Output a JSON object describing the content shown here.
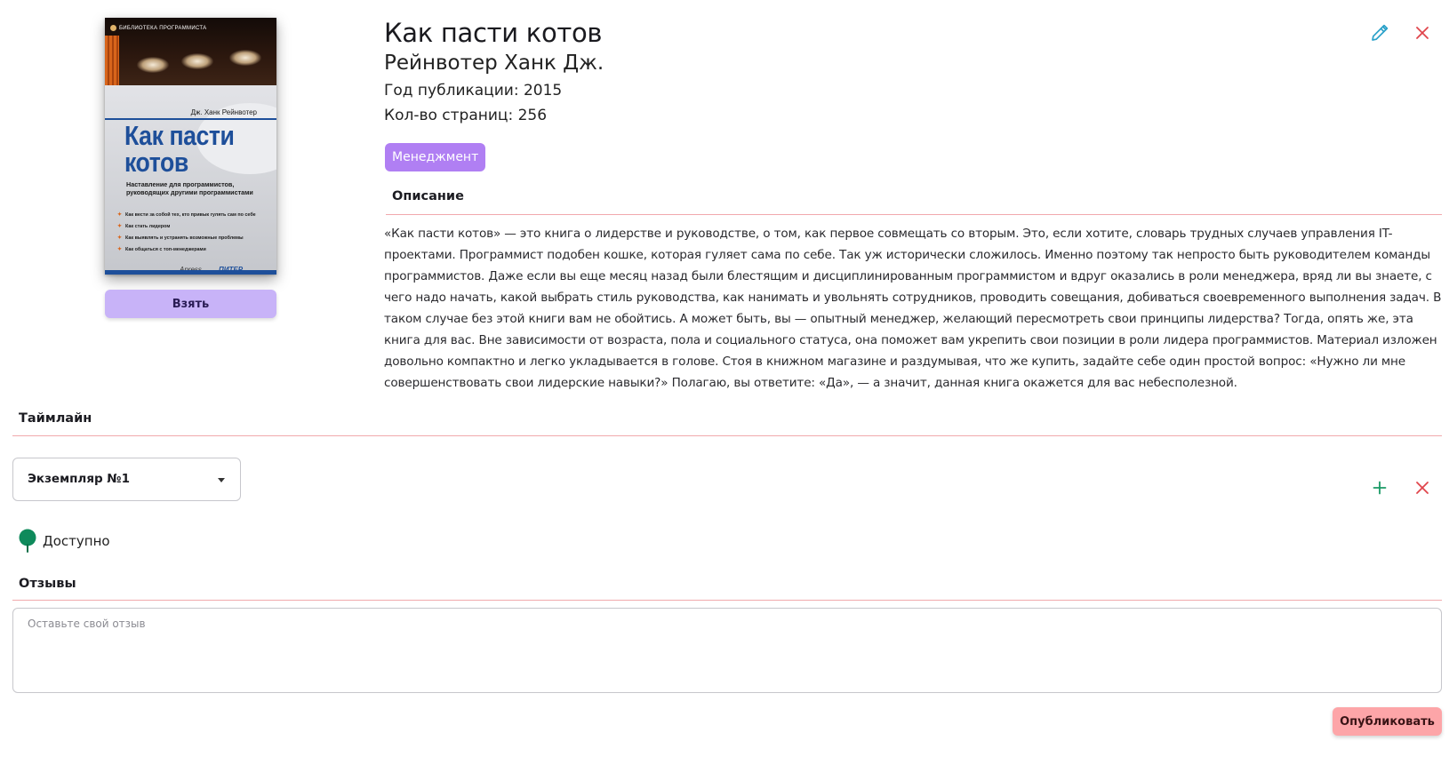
{
  "book": {
    "title": "Как пасти котов",
    "author": "Рейнвотер Ханк Дж.",
    "year_text": "Год публикации: 2015",
    "pages_text": "Кол-во страниц: 256",
    "tag": "Менеджмент",
    "take_label": "Взять"
  },
  "cover": {
    "series": "БИБЛИОТЕКА ПРОГРАММИСТА",
    "author": "Дж. Ханк Рейнвотер",
    "title_line1": "Как пасти",
    "title_line2": "котов",
    "subtitle": "Наставление для программистов, руководящих другими программистами",
    "bullets": [
      "Как вести за собой тех, кто привык гулять сам по себе",
      "Как стать лидером",
      "Как выявлять и устранять возможные проблемы",
      "Как общаться с топ-менеджерами"
    ],
    "publisher1": "Apress",
    "publisher2": "ПИТЕР"
  },
  "description": {
    "heading": "Описание",
    "text": "«Как пасти котов» — это книга о лидерстве и руководстве, о том, как первое совмещать со вторым. Это, если хотите, словарь трудных случаев управления IT-проектами. Программист подобен кошке, которая гуляет сама по себе. Так уж исторически сложилось. Именно поэтому так непросто быть руководителем команды программистов. Даже если вы еще месяц назад были блестящим и дисциплинированным программистом и вдруг оказались в роли менеджера, вряд ли вы знаете, с чего надо начать, какой выбрать стиль руководства, как нанимать и увольнять сотрудников, проводить совещания, добиваться своевременного выполнения задач. В таком случае без этой книги вам не обойтись. А может быть, вы — опытный менеджер, желающий пересмотреть свои принципы лидерства? Тогда, опять же, эта книга для вас. Вне зависимости от возраста, пола и социального статуса, она поможет вам укрепить свои позиции в роли лидера программистов. Материал изложен довольно компактно и легко укладывается в голове. Стоя в книжном магазине и раздумывая, что же купить, задайте себе один простой вопрос: «Нужно ли мне совершенствовать свои лидерские навыки?» Полагаю, вы ответите: «Да», — а значит, данная книга окажется для вас небесполезной."
  },
  "timeline": {
    "heading": "Таймлайн",
    "copy_selected": "Экземпляр №1",
    "status": "Доступно"
  },
  "reviews": {
    "heading": "Отзывы",
    "placeholder": "Оставьте свой отзыв",
    "publish_label": "Опубликовать"
  },
  "icons": {
    "edit": "pencil-icon",
    "close": "close-icon",
    "add": "plus-icon",
    "status": "map-pin-icon"
  },
  "colors": {
    "accent_purple": "#b07ff3",
    "take_button": "#c8b3f8",
    "publish_button": "#fda5a8",
    "divider": "#f1a9ad",
    "edit_icon": "#2aa1c9",
    "close_icon": "#e0454c",
    "add_icon": "#1a9a66",
    "status_green": "#0e8a5b"
  }
}
